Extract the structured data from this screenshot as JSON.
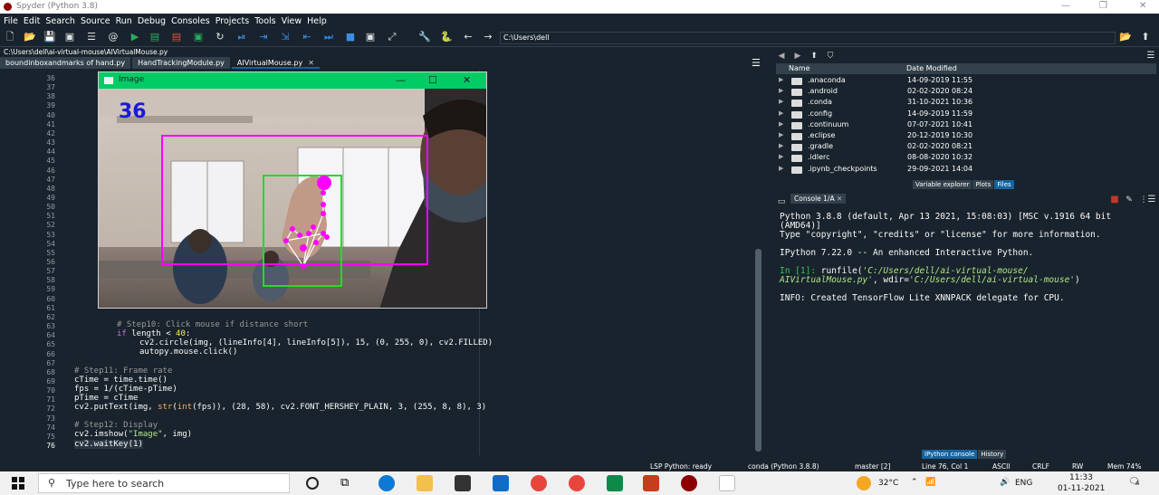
{
  "window": {
    "title": "Spyder (Python 3.8)"
  },
  "menu": [
    "File",
    "Edit",
    "Search",
    "Source",
    "Run",
    "Debug",
    "Consoles",
    "Projects",
    "Tools",
    "View",
    "Help"
  ],
  "toolbar": {
    "path": "C:\\Users\\dell"
  },
  "editor": {
    "file_path": "C:\\Users\\dell\\ai-virtual-mouse\\AIVirtualMouse.py",
    "tabs": [
      {
        "label": "boundinboxandmarks of hand.py"
      },
      {
        "label": "HandTrackingModule.py"
      },
      {
        "label": "AIVirtualMouse.py"
      }
    ],
    "line_numbers": [
      "36",
      "37",
      "38",
      "39",
      "40",
      "41",
      "42",
      "43",
      "44",
      "45",
      "46",
      "47",
      "48",
      "49",
      "50",
      "51",
      "52",
      "53",
      "54",
      "55",
      "56",
      "57",
      "58",
      "59",
      "60",
      "61",
      "62",
      "63",
      "64",
      "65",
      "66",
      "67",
      "68",
      "69",
      "70",
      "71",
      "72",
      "73",
      "74",
      "75",
      "76"
    ],
    "code": {
      "l63_comment": "# Step10: Click mouse if distance short",
      "l64_kw": "if",
      "l64_rest": " length < ",
      "l64_num": "40",
      "l64_end": ":",
      "l65": "cv2.circle(img, (lineInfo[4], lineInfo[5]), 15, (0, 255, 0), cv2.FILLED)",
      "l66": "autopy.mouse.click()",
      "l68_comment": "# Step11: Frame rate",
      "l69": "cTime = time.time()",
      "l70": "fps = 1/(cTime-pTime)",
      "l71": "pTime = cTime",
      "l72_a": "cv2.putText(img, ",
      "l72_b": "str",
      "l72_c": "(",
      "l72_d": "int",
      "l72_e": "(fps)), (28, 58), cv2.FONT_HERSHEY_PLAIN, 3, (255, 8, 8), 3)",
      "l74_comment": "# Step12: Display",
      "l75_a": "cv2.imshow(",
      "l75_b": "\"Image\"",
      "l75_c": ", img)",
      "l76": "cv2.waitKey(1)"
    }
  },
  "image_window": {
    "title": "Image",
    "fps_text": "36"
  },
  "files": {
    "columns": {
      "name": "Name",
      "date": "Date Modified"
    },
    "rows": [
      {
        "name": ".anaconda",
        "date": "14-09-2019 11:55"
      },
      {
        "name": ".android",
        "date": "02-02-2020 08:24"
      },
      {
        "name": ".conda",
        "date": "31-10-2021 10:36"
      },
      {
        "name": ".config",
        "date": "14-09-2019 11:59"
      },
      {
        "name": ".continuum",
        "date": "07-07-2021 10:41"
      },
      {
        "name": ".eclipse",
        "date": "20-12-2019 10:30"
      },
      {
        "name": ".gradle",
        "date": "02-02-2020 08:21"
      },
      {
        "name": ".idlerc",
        "date": "08-08-2020 10:32"
      },
      {
        "name": ".ipynb_checkpoints",
        "date": "29-09-2021 14:04"
      }
    ],
    "tabs": [
      "Variable explorer",
      "Plots",
      "Files"
    ]
  },
  "console": {
    "tab": "Console 1/A",
    "lines": [
      "Python 3.8.8 (default, Apr 13 2021, 15:08:03) [MSC v.1916 64 bit",
      "(AMD64)]",
      "Type \"copyright\", \"credits\" or \"license\" for more information.",
      "IPython 7.22.0 -- An enhanced Interactive Python."
    ],
    "prompt": "In [1]:",
    "cmd_a": " runfile(",
    "cmd_path1": "'C:/Users/dell/ai-virtual-mouse/",
    "cmd_path2": "AIVirtualMouse.py'",
    "cmd_mid": ", wdir=",
    "cmd_path3": "'C:/Users/dell/ai-virtual-mouse'",
    "cmd_end": ")",
    "info": "INFO: Created TensorFlow Lite XNNPACK delegate for CPU.",
    "bottom_tabs": [
      "IPython console",
      "History"
    ]
  },
  "statusbar": {
    "lsp": "LSP Python: ready",
    "conda": "conda (Python 3.8.8)",
    "git": "master [2]",
    "cursor": "Line 76, Col 1",
    "encoding": "ASCII",
    "eol": "CRLF",
    "perm": "RW",
    "mem": "Mem 74%"
  },
  "taskbar": {
    "search_placeholder": "Type here to search",
    "temp": "32°C",
    "lang": "ENG",
    "time": "11:33",
    "date": "01-11-2021",
    "notif": "4"
  }
}
